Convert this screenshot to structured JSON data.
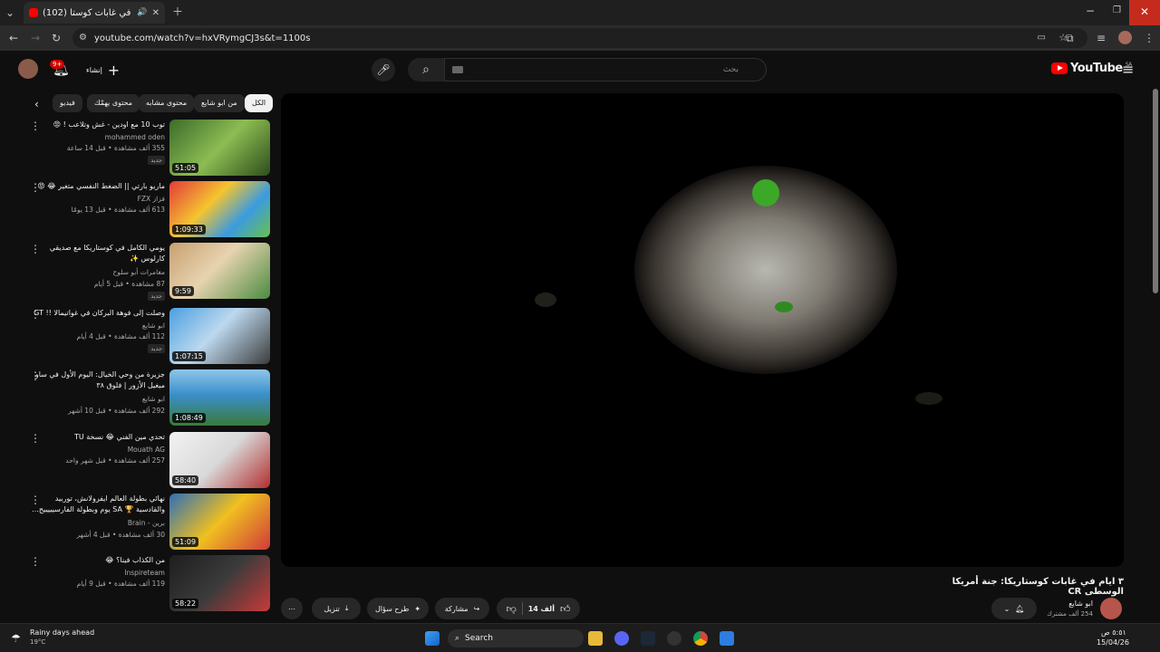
{
  "browser": {
    "tab_title": "(102) ٣ ايام في غابات كوستا...",
    "url": "youtube.com/watch?v=hxVRymgCJ3s&t=1100s"
  },
  "header": {
    "search_placeholder": "بحث",
    "logo_text": "YouTube",
    "logo_region": "SA",
    "create_label": "إنشاء",
    "notif_count": "9+"
  },
  "chips": [
    "الكل",
    "من ابو شايع",
    "محتوى مشابه",
    "محتوى يهمّك",
    "فيديو"
  ],
  "videos": [
    {
      "title": "توب 10 مع اودين - غش وتلاعب ! 😡",
      "channel": "mohammed oden",
      "meta": "355 ألف مشاهدة • قبل 14 ساعة",
      "badge": "جديد",
      "duration": "51:05"
    },
    {
      "title": "ماريو بارتي || الضغط النفسي متغير 😂 😡",
      "channel": "فزاز FZX",
      "meta": "613 ألف مشاهدة • قبل 13 يومًا",
      "badge": "",
      "duration": "1:09:33"
    },
    {
      "title": "يومي الكامل في كوستاريكا مع صديقي كارلوس ✨",
      "channel": "مغامرات أبو سلوح",
      "meta": "87 مشاهدة • قبل 5 أيام",
      "badge": "جديد",
      "duration": "9:59"
    },
    {
      "title": "وصلت إلى فوهة البركان في غواتيمالا !! GT",
      "channel": "ابو شايع",
      "meta": "112 ألف مشاهدة • قبل 4 أيام",
      "badge": "جديد",
      "duration": "1:07:15"
    },
    {
      "title": "جزيرة من وحي الخيال: اليوم الأول في ساو ميغيل الأزور | فلوق ٣٨",
      "channel": "ابو شايع",
      "meta": "292 ألف مشاهدة • قبل 10 أشهر",
      "badge": "",
      "duration": "1:08:49"
    },
    {
      "title": "تحدي مين الفني 😂 نسخة TU",
      "channel": "Mouath AG",
      "meta": "257 ألف مشاهدة • قبل شهر واحد",
      "badge": "",
      "duration": "58:40"
    },
    {
      "title": "نهائي بطولة العالم ايفرولانش، توربيد والقادسية 🏆 SA يوم وبطولة الفارسيييييح...",
      "channel": "برين - Brain",
      "meta": "30 ألف مشاهدة • قبل 4 أشهر",
      "badge": "",
      "duration": "51:09"
    },
    {
      "title": "من الكذاب فينا؟ 😂",
      "channel": "Inspireteam",
      "meta": "119 ألف مشاهدة • قبل 9 أيام",
      "badge": "",
      "duration": "58:22"
    }
  ],
  "watch": {
    "title": "٣ ايام في غابات كوستاريكا: جنة أمريكا الوسطى CR",
    "channel": "ابو شايع",
    "subscribers": "254 ألف مشترك",
    "likes": "14 ألف",
    "share_label": "مشاركة",
    "ask_label": "طرح سؤال",
    "download_label": "تنزيل"
  },
  "taskbar": {
    "weather_title": "Rainy days ahead",
    "weather_temp": "19°C",
    "search_label": "Search",
    "time": "٥:٥١ ص",
    "date": "15/04/26"
  },
  "colors": {
    "accent": "#ff0000",
    "page_bg": "#0f0f0f"
  }
}
